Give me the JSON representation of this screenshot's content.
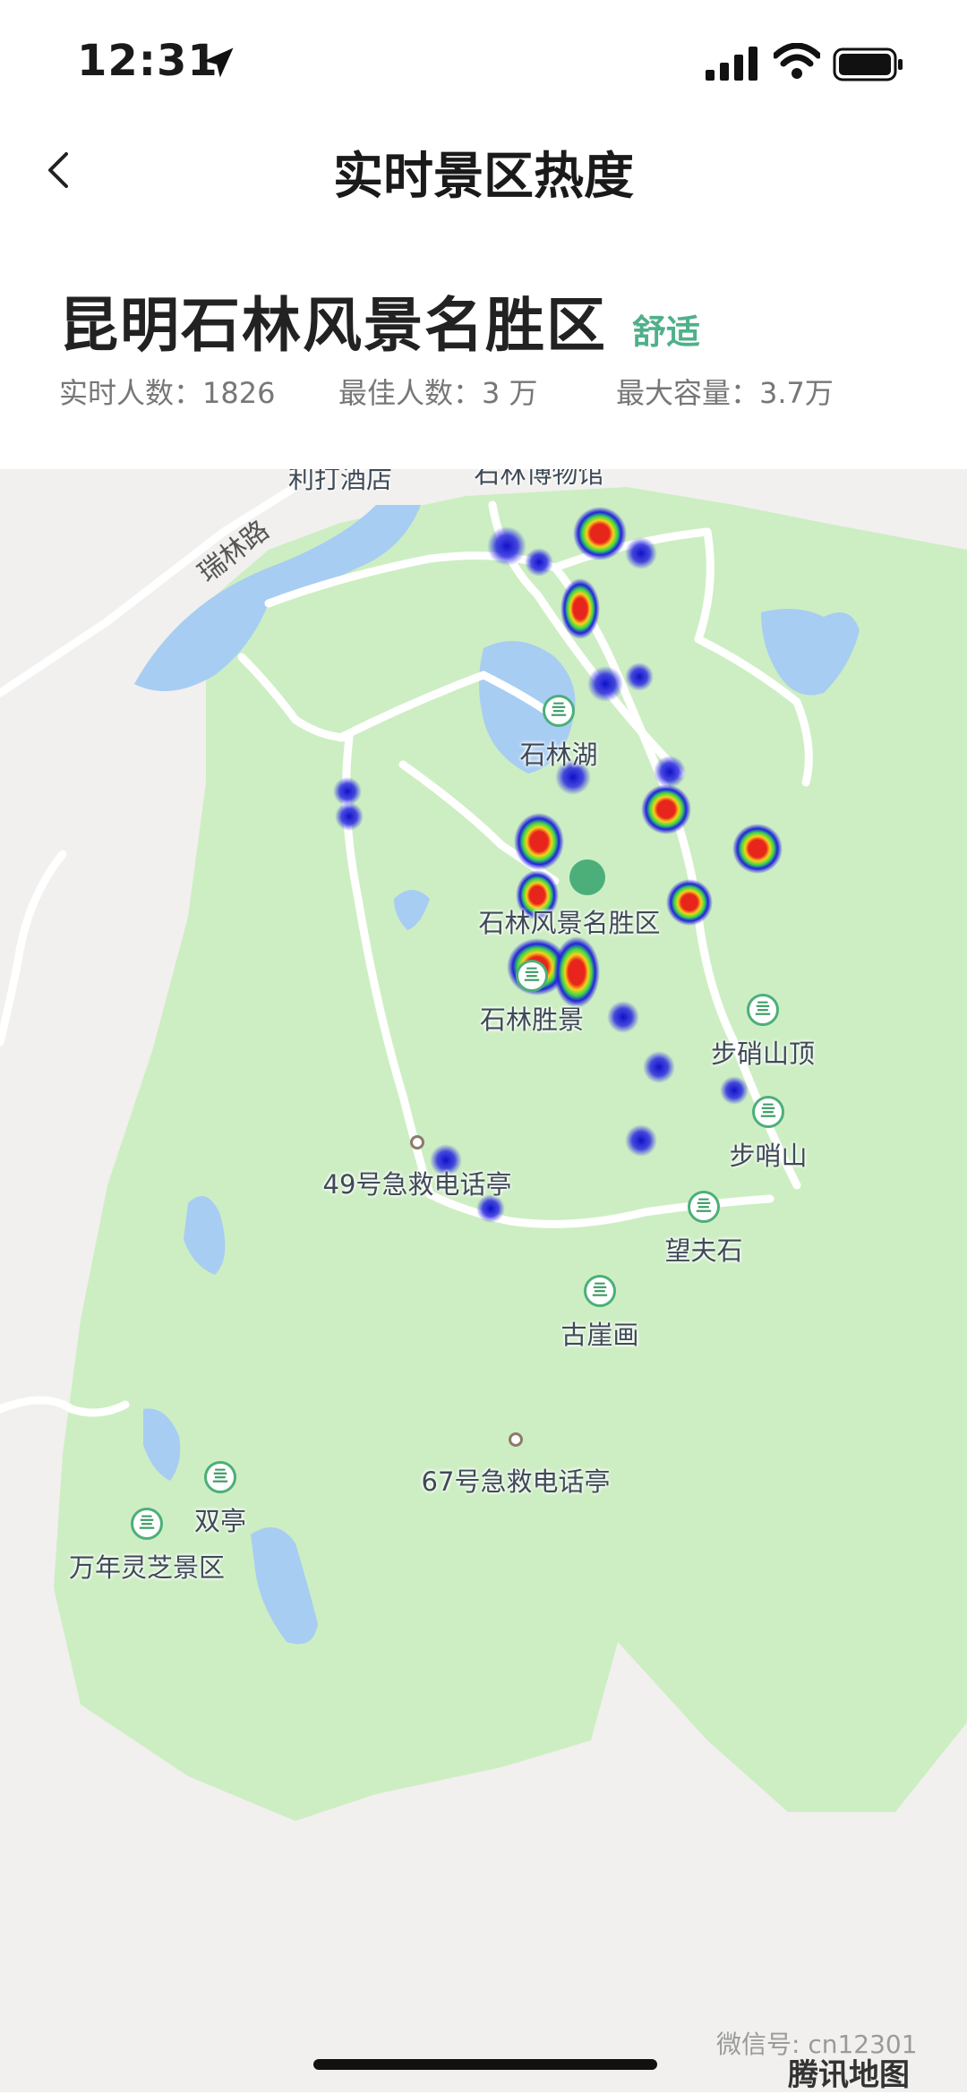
{
  "status_bar": {
    "time": "12:31"
  },
  "nav": {
    "title": "实时景区热度"
  },
  "scenic": {
    "name": "昆明石林风景名胜区",
    "comfort": "舒适",
    "stats": [
      {
        "label": "实时人数：1826"
      },
      {
        "label": "最佳人数：3 万"
      },
      {
        "label": "最大容量：3.7万"
      }
    ]
  },
  "map": {
    "road_label": "瑞林路",
    "cut_labels": [
      "利打酒店",
      "石林博物馆"
    ],
    "pois": [
      {
        "name": "石林湖",
        "icon": "scenic-spot-icon"
      },
      {
        "name": "石林风景名胜区",
        "icon": "camera-icon"
      },
      {
        "name": "石林胜景",
        "icon": "scenic-spot-icon"
      },
      {
        "name": "步硝山顶",
        "icon": "scenic-spot-icon"
      },
      {
        "name": "步哨山",
        "icon": "scenic-spot-icon"
      },
      {
        "name": "49号急救电话亭",
        "icon": "point-icon"
      },
      {
        "name": "望夫石",
        "icon": "scenic-spot-icon"
      },
      {
        "name": "古崖画",
        "icon": "scenic-spot-icon"
      },
      {
        "name": "67号急救电话亭",
        "icon": "point-icon"
      },
      {
        "name": "双亭",
        "icon": "scenic-spot-icon"
      },
      {
        "name": "万年灵芝景区",
        "icon": "scenic-spot-icon"
      }
    ],
    "watermark": "微信号: cn12301",
    "logo": "腾讯地图",
    "colors": {
      "park": "#cdeec3",
      "water": "#a8cdf3",
      "road": "#ffffff",
      "background": "#f1f0ee",
      "heat_hot": "#e8251c",
      "heat_cool": "#2222dd"
    }
  }
}
